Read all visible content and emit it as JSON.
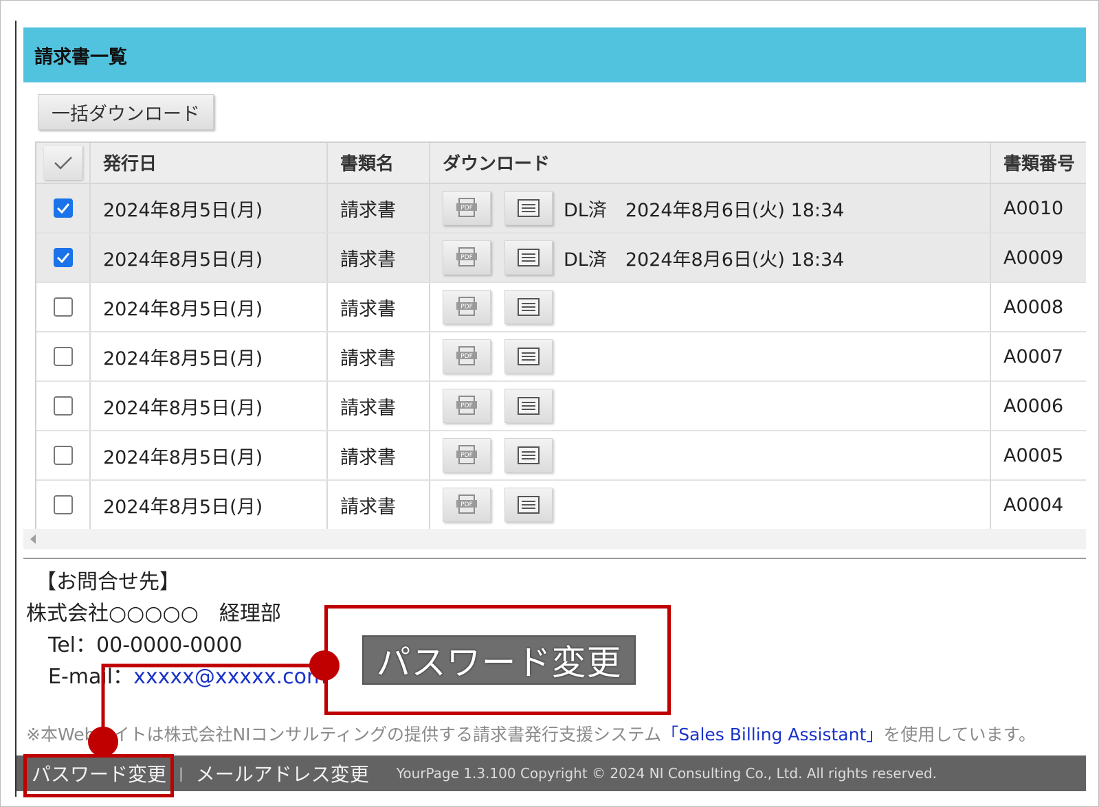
{
  "panel": {
    "title": "請求書一覧",
    "bulk_download_label": "一括ダウンロード"
  },
  "table": {
    "columns": {
      "issue_date": "発行日",
      "doc_name": "書類名",
      "download": "ダウンロード",
      "doc_number": "書類番号"
    },
    "rows": [
      {
        "checked": true,
        "date": "2024年8月5日(月)",
        "name": "請求書",
        "status": "DL済　2024年8月6日(火) 18:34",
        "number": "A0010"
      },
      {
        "checked": true,
        "date": "2024年8月5日(月)",
        "name": "請求書",
        "status": "DL済　2024年8月6日(火) 18:34",
        "number": "A0009"
      },
      {
        "checked": false,
        "date": "2024年8月5日(月)",
        "name": "請求書",
        "status": "",
        "number": "A0008"
      },
      {
        "checked": false,
        "date": "2024年8月5日(月)",
        "name": "請求書",
        "status": "",
        "number": "A0007"
      },
      {
        "checked": false,
        "date": "2024年8月5日(月)",
        "name": "請求書",
        "status": "",
        "number": "A0006"
      },
      {
        "checked": false,
        "date": "2024年8月5日(月)",
        "name": "請求書",
        "status": "",
        "number": "A0005"
      },
      {
        "checked": false,
        "date": "2024年8月5日(月)",
        "name": "請求書",
        "status": "",
        "number": "A0004"
      }
    ]
  },
  "contact": {
    "heading": "【お問合せ先】",
    "company": "株式会社○○○○○　経理部",
    "tel": "Tel：00-0000-0000",
    "email_label": "E-mail：",
    "email": "xxxxx@xxxxx.com"
  },
  "callout": {
    "button_label": "パスワード変更",
    "accent_color": "#c00000"
  },
  "notice": {
    "prefix": "※本Webサイトは株式会社NIコンサルティングの提供する請求書発行支援システム",
    "link": "「Sales Billing Assistant」",
    "suffix": "を使用しています。"
  },
  "footer": {
    "password_change": "パスワード変更",
    "separator": "|",
    "email_change": "メールアドレス変更",
    "copyright": "YourPage 1.3.100 Copyright © 2024 NI Consulting Co., Ltd. All rights reserved."
  },
  "colors": {
    "header_bar": "#52c3df",
    "checkbox_checked": "#1a73e8",
    "footer_bar": "#636363",
    "link": "#1a33c8"
  }
}
